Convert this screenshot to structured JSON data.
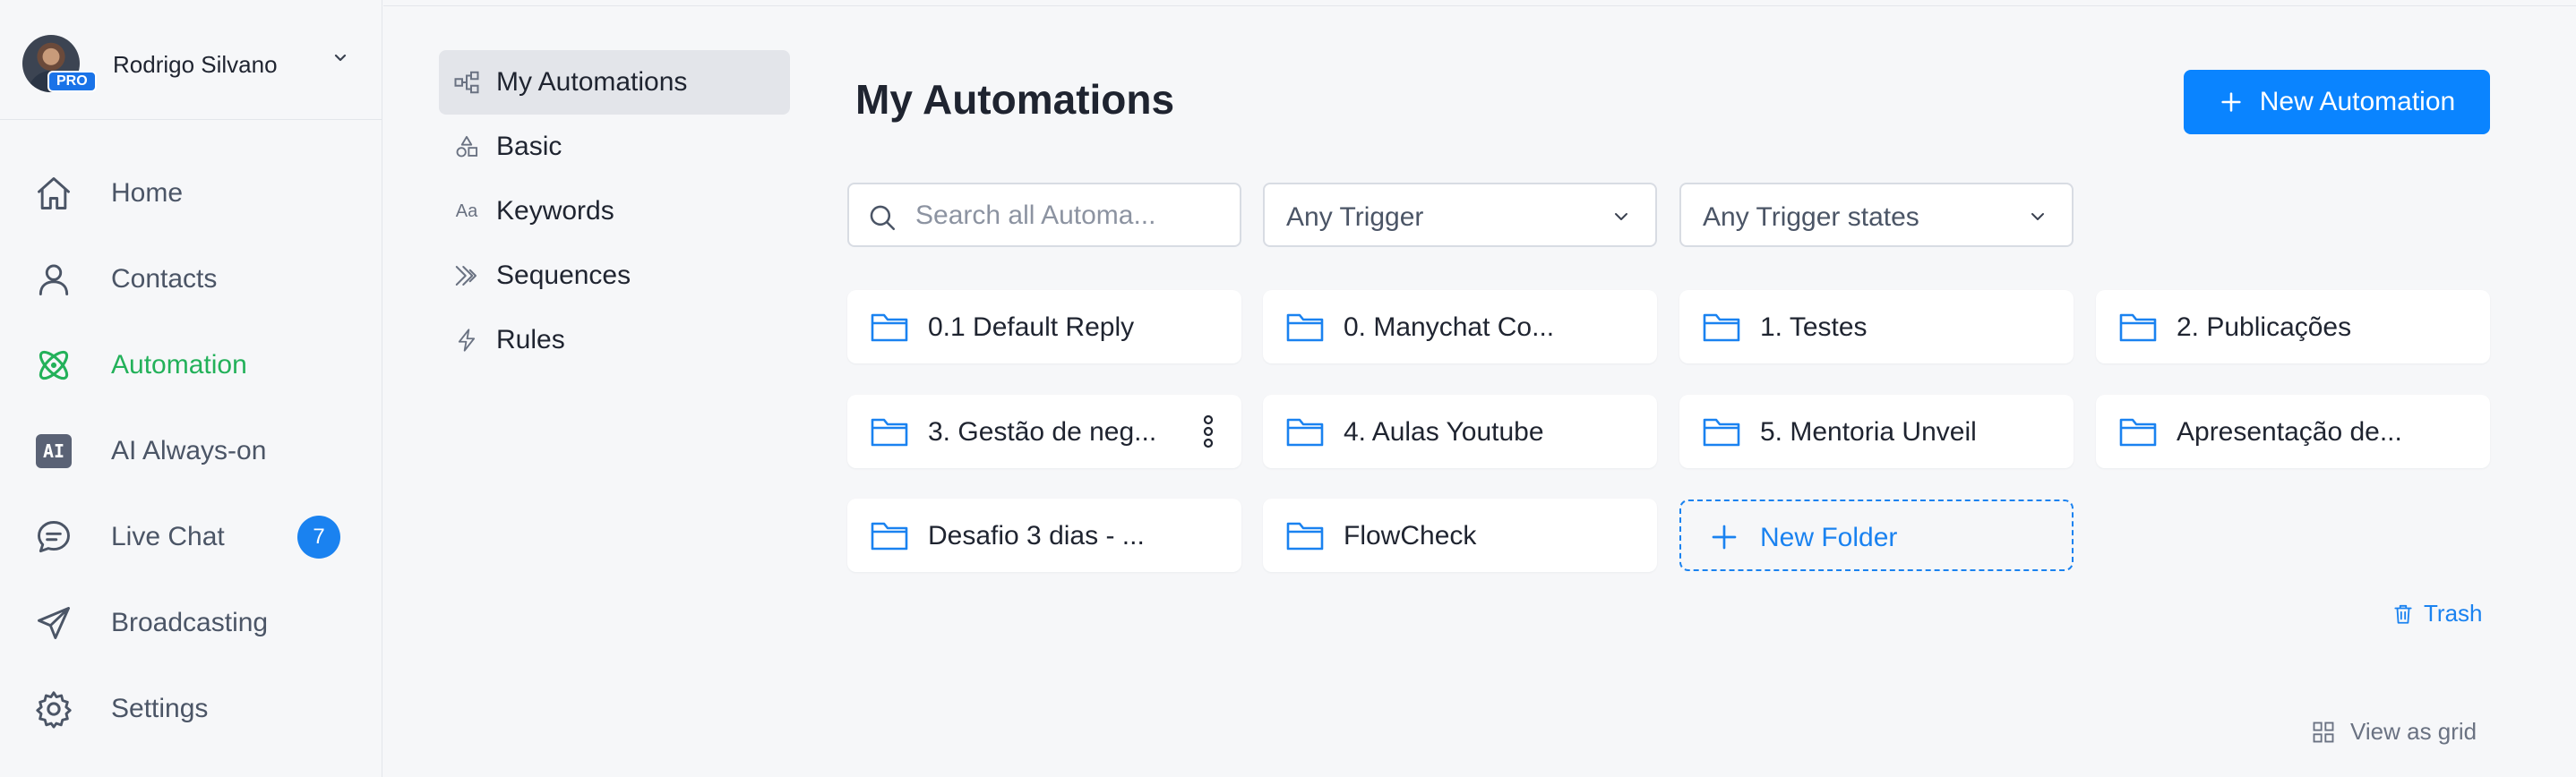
{
  "profile": {
    "name": "Rodrigo Silvano",
    "badge": "PRO"
  },
  "nav": {
    "items": [
      {
        "label": "Home",
        "icon": "home-icon"
      },
      {
        "label": "Contacts",
        "icon": "person-icon"
      },
      {
        "label": "Automation",
        "icon": "atom-icon",
        "active": true
      },
      {
        "label": "AI Always-on",
        "icon": "ai-icon",
        "icon_text": "AI"
      },
      {
        "label": "Live Chat",
        "icon": "chat-icon",
        "badge": "7"
      },
      {
        "label": "Broadcasting",
        "icon": "send-icon"
      },
      {
        "label": "Settings",
        "icon": "gear-icon"
      }
    ]
  },
  "subnav": {
    "items": [
      {
        "label": "My Automations",
        "icon": "flow-icon",
        "active": true
      },
      {
        "label": "Basic",
        "icon": "shapes-icon"
      },
      {
        "label": "Keywords",
        "icon": "text-icon",
        "icon_text": "Aa"
      },
      {
        "label": "Sequences",
        "icon": "sequence-icon"
      },
      {
        "label": "Rules",
        "icon": "bolt-icon"
      }
    ]
  },
  "main": {
    "title": "My Automations",
    "new_automation_label": "New Automation",
    "search_placeholder": "Search all Automa...",
    "trigger_filter": "Any Trigger",
    "trigger_state_filter": "Any Trigger states",
    "folders": [
      "0.1 Default Reply",
      "0. Manychat Co...",
      "1. Testes",
      "2. Publicações",
      "3. Gestão de neg...",
      "4. Aulas Youtube",
      "5. Mentoria Unveil",
      "Apresentação de...",
      "Desafio 3 dias - ...",
      "FlowCheck"
    ],
    "new_folder_label": "New Folder",
    "trash_label": "Trash",
    "view_grid_label": "View as grid"
  },
  "colors": {
    "accent": "#0a84ff",
    "active_nav": "#23b15a",
    "badge": "#1a82f0",
    "folder_icon": "#1a82f0"
  }
}
